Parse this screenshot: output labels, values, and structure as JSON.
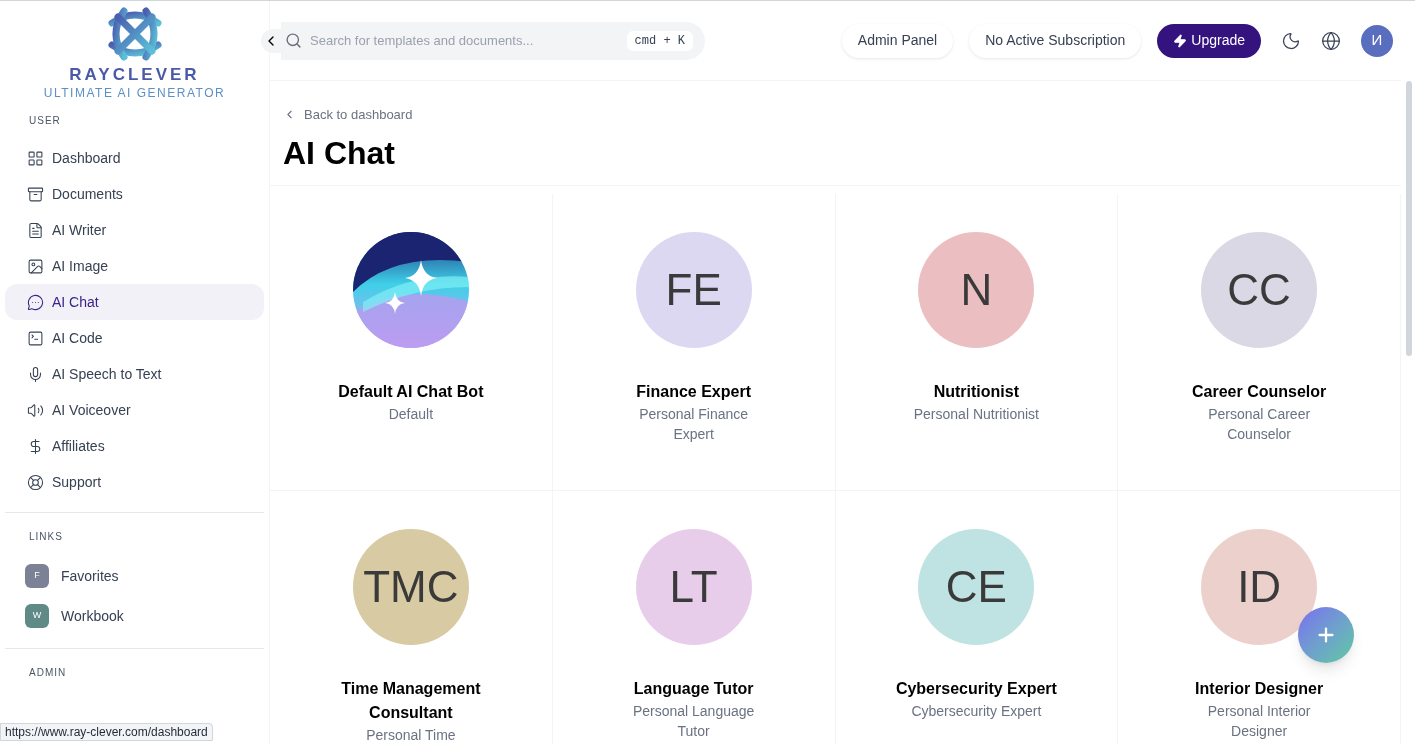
{
  "logo": {
    "name": "RAYCLEVER",
    "tagline": "ULTIMATE AI GENERATOR"
  },
  "sidebar": {
    "sections": [
      {
        "title": "USER",
        "kind": "nav",
        "items": [
          {
            "label": "Dashboard",
            "selected": false
          },
          {
            "label": "Documents",
            "selected": false
          },
          {
            "label": "AI Writer",
            "selected": false
          },
          {
            "label": "AI Image",
            "selected": false
          },
          {
            "label": "AI Chat",
            "selected": true
          },
          {
            "label": "AI Code",
            "selected": false
          },
          {
            "label": "AI Speech to Text",
            "selected": false
          },
          {
            "label": "AI Voiceover",
            "selected": false
          },
          {
            "label": "Affiliates",
            "selected": false
          },
          {
            "label": "Support",
            "selected": false
          }
        ]
      },
      {
        "title": "LINKS",
        "kind": "links",
        "items": [
          {
            "label": "Favorites",
            "initial": "F",
            "color": "#7c8196"
          },
          {
            "label": "Workbook",
            "initial": "W",
            "color": "#5f8a85"
          }
        ]
      },
      {
        "title": "ADMIN"
      }
    ]
  },
  "status_url": "https://www.ray-clever.com/dashboard",
  "header": {
    "search": {
      "placeholder": "Search for templates and documents...",
      "shortcut": "cmd + K"
    },
    "buttons": [
      "Admin Panel",
      "No Active Subscription"
    ],
    "upgrade": "Upgrade",
    "avatar": "И"
  },
  "back_link": "Back to dashboard",
  "title": "AI Chat",
  "cards": [
    {
      "kind": "image",
      "name": "Default AI Chat Bot",
      "role": "Default"
    },
    {
      "kind": "initials",
      "initials": "FE",
      "color": "#dcd8f2",
      "name": "Finance Expert",
      "role": "Personal Finance Expert"
    },
    {
      "kind": "initials",
      "initials": "N",
      "color": "#ebbfc2",
      "name": "Nutritionist",
      "role": "Personal Nutritionist"
    },
    {
      "kind": "initials",
      "initials": "CC",
      "color": "#d9d8e4",
      "name": "Career Counselor",
      "role": "Personal Career Counselor"
    },
    {
      "kind": "initials",
      "initials": "TMC",
      "color": "#d8cba3",
      "name": "Time Management Consultant",
      "role": "Personal Time"
    },
    {
      "kind": "initials",
      "initials": "LT",
      "color": "#e8cdea",
      "name": "Language Tutor",
      "role": "Personal Language Tutor"
    },
    {
      "kind": "initials",
      "initials": "CE",
      "color": "#bfe3e2",
      "name": "Cybersecurity Expert",
      "role": "Cybersecurity Expert"
    },
    {
      "kind": "initials",
      "initials": "ID",
      "color": "#ecd0cb",
      "name": "Interior Designer",
      "role": "Personal Interior Designer"
    }
  ]
}
